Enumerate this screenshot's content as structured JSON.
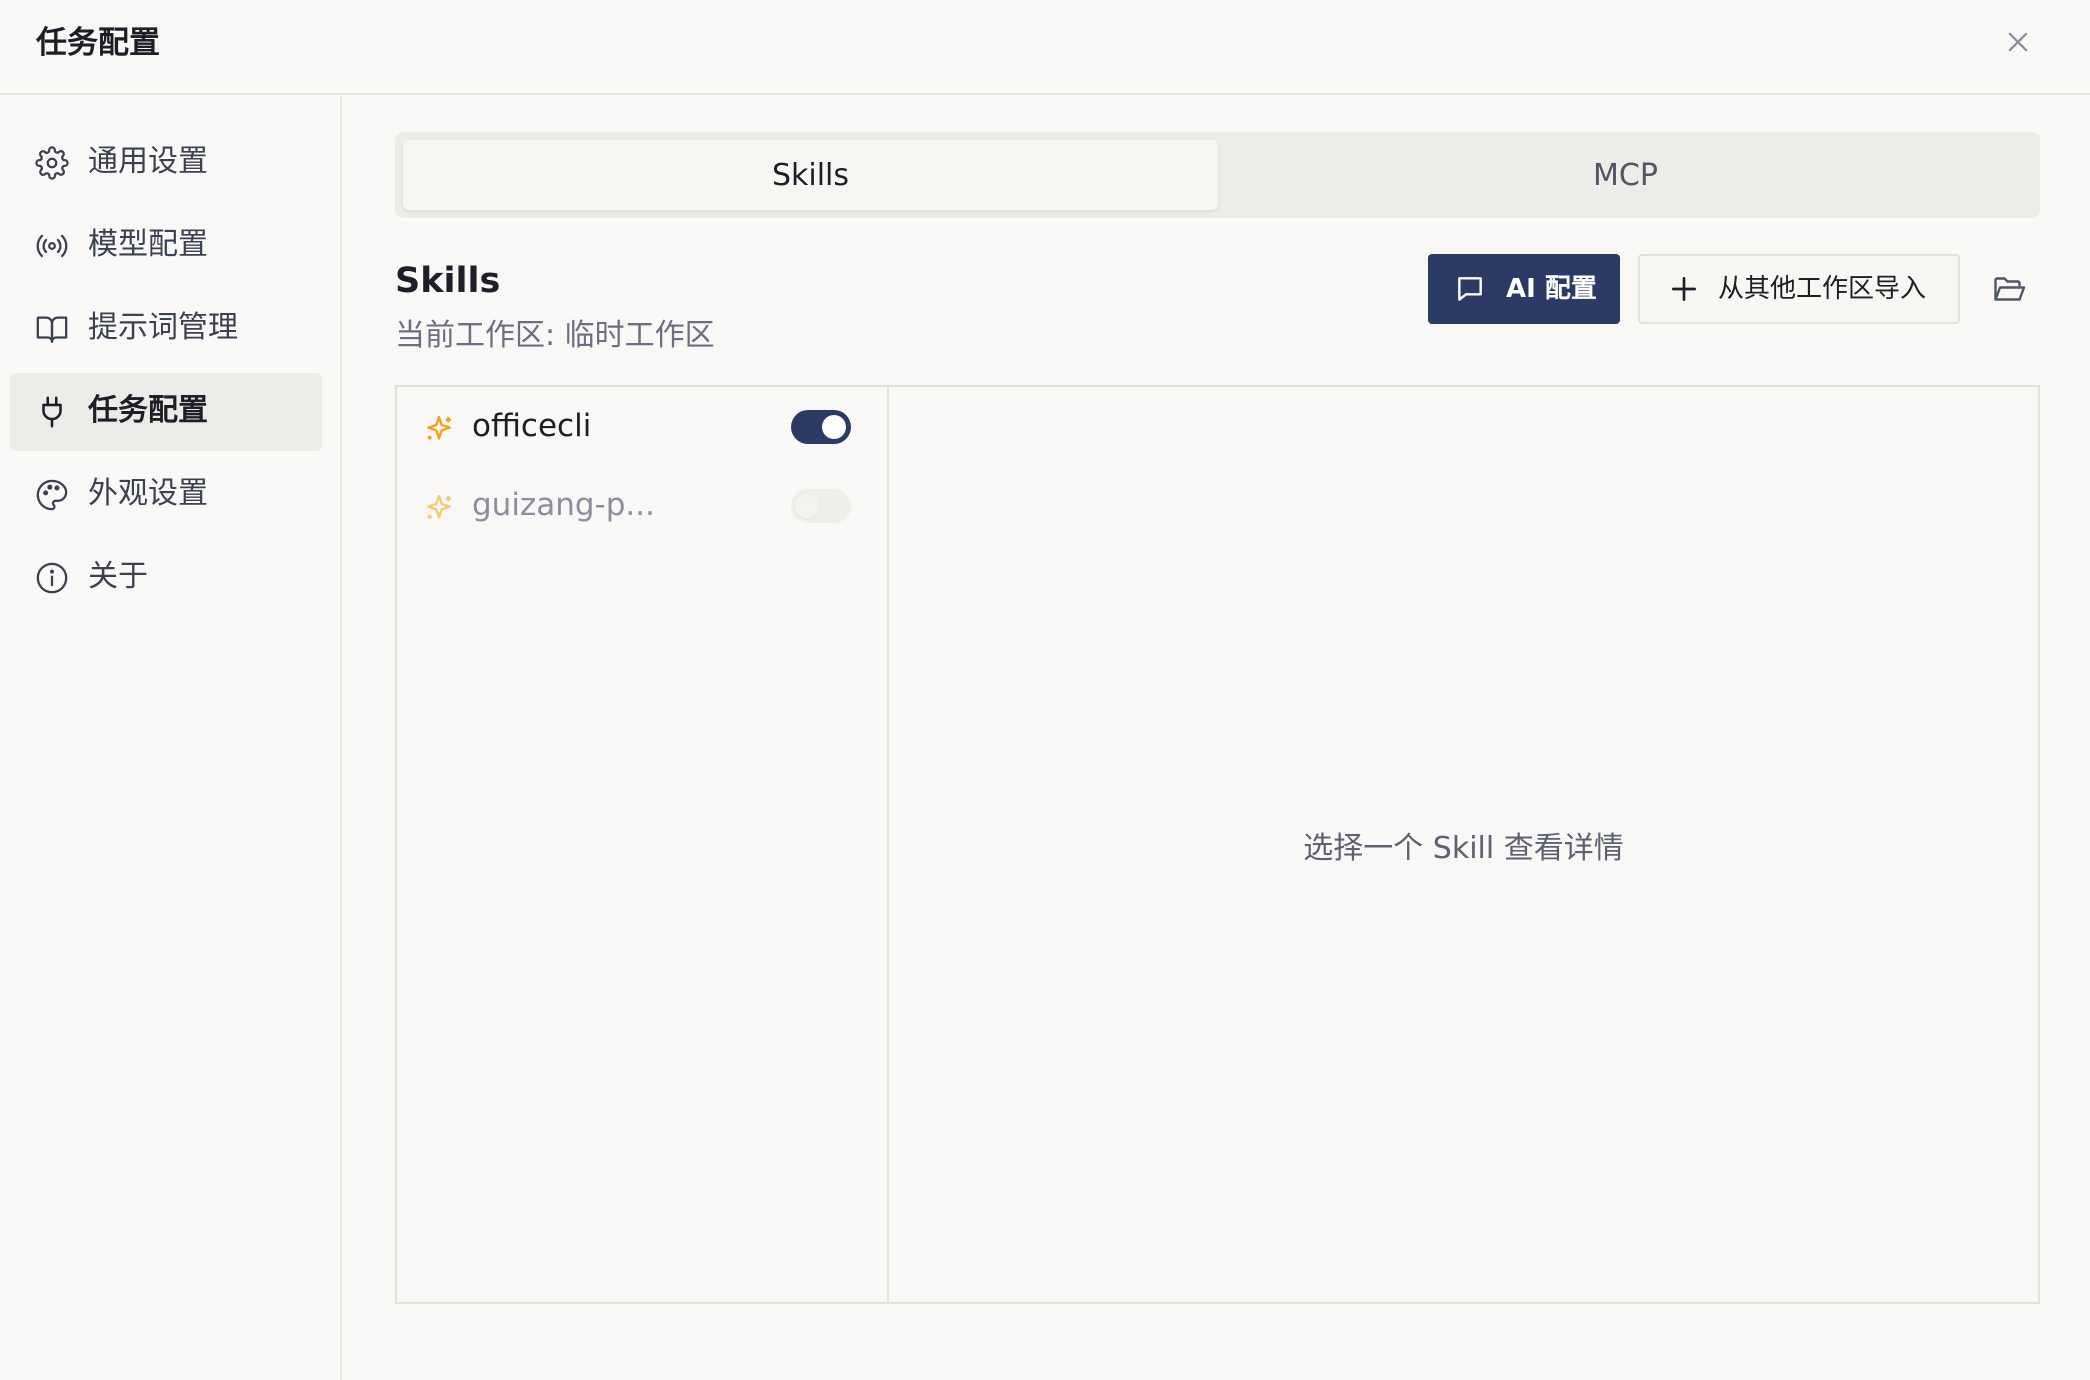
{
  "header": {
    "title": "任务配置",
    "close_icon": "close-icon"
  },
  "sidebar": {
    "items": [
      {
        "label": "通用设置",
        "icon": "gear-icon",
        "active": false
      },
      {
        "label": "模型配置",
        "icon": "broadcast-icon",
        "active": false
      },
      {
        "label": "提示词管理",
        "icon": "book-icon",
        "active": false
      },
      {
        "label": "任务配置",
        "icon": "plug-icon",
        "active": true
      },
      {
        "label": "外观设置",
        "icon": "palette-icon",
        "active": false
      },
      {
        "label": "关于",
        "icon": "info-icon",
        "active": false
      }
    ]
  },
  "tabs": [
    {
      "label": "Skills",
      "active": true
    },
    {
      "label": "MCP",
      "active": false
    }
  ],
  "section": {
    "title": "Skills",
    "subtitle": "当前工作区: 临时工作区"
  },
  "actions": {
    "ai_config_label": "AI 配置",
    "import_label": "从其他工作区导入",
    "folder_icon": "folder-open-icon"
  },
  "skills": [
    {
      "name": "officecli",
      "enabled": true,
      "icon": "sparkle-icon"
    },
    {
      "name": "guizang-p...",
      "enabled": false,
      "icon": "sparkle-icon"
    }
  ],
  "detail": {
    "empty_text": "选择一个 Skill 查看详情"
  },
  "colors": {
    "accent": "#2c3a66",
    "sparkle": "#f0a21a"
  }
}
